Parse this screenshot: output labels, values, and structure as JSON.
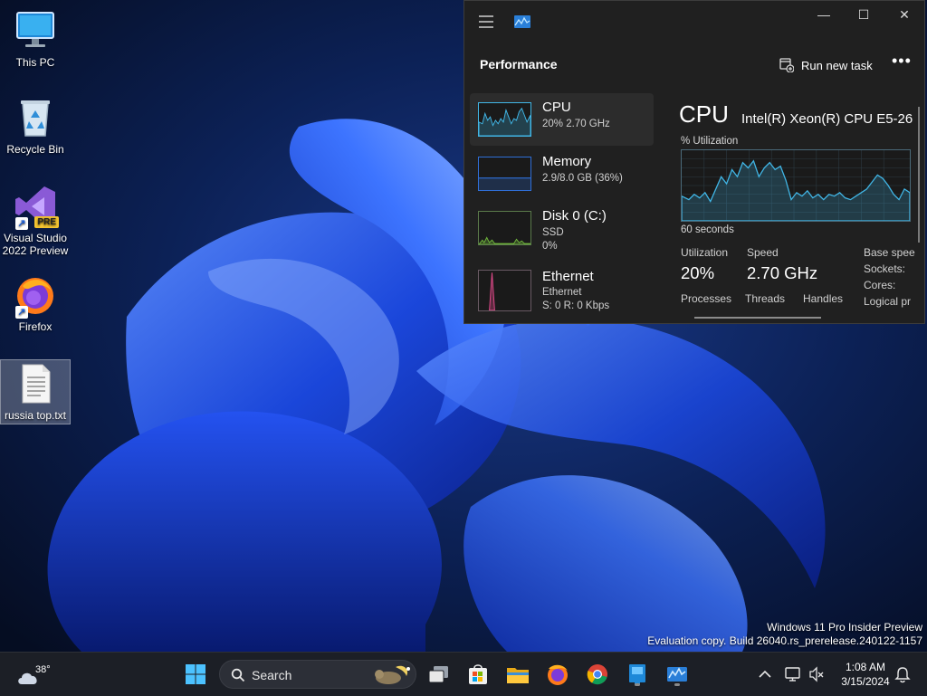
{
  "desktop": {
    "icons": [
      {
        "label": "This PC"
      },
      {
        "label": "Recycle Bin"
      },
      {
        "label": "Visual Studio 2022 Preview",
        "badge": "PRE"
      },
      {
        "label": "Firefox"
      },
      {
        "label": "russia top.txt"
      }
    ],
    "watermark": {
      "line1": "Windows 11 Pro Insider Preview",
      "line2": "Evaluation copy. Build 26040.rs_prerelease.240122-1157"
    }
  },
  "task_manager": {
    "controls": {
      "minimize": "—",
      "maximize": "☐",
      "close": "✕"
    },
    "page_title": "Performance",
    "run_new_task": "Run new task",
    "more": "•••",
    "perf_items": [
      {
        "name": "CPU",
        "sub1": "20% 2.70 GHz",
        "sub2": ""
      },
      {
        "name": "Memory",
        "sub1": "2.9/8.0 GB (36%)",
        "sub2": ""
      },
      {
        "name": "Disk 0 (C:)",
        "sub1": "SSD",
        "sub2": "0%"
      },
      {
        "name": "Ethernet",
        "sub1": "Ethernet",
        "sub2": "S: 0 R: 0 Kbps"
      }
    ],
    "detail": {
      "title": "CPU",
      "model": "Intel(R) Xeon(R) CPU E5-26",
      "graph_label": "% Utilization",
      "graph_span": "60 seconds",
      "utilization_label": "Utilization",
      "utilization_value": "20%",
      "speed_label": "Speed",
      "speed_value": "2.70 GHz",
      "processes_label": "Processes",
      "threads_label": "Threads",
      "handles_label": "Handles",
      "base_speed_label": "Base spee",
      "sockets_label": "Sockets:",
      "cores_label": "Cores:",
      "logical_label": "Logical pr"
    },
    "colors": {
      "cpu": "#41b6e6",
      "memory": "#2f6fd8",
      "disk": "#6fb53c",
      "ethernet": "#e04a8a"
    }
  },
  "taskbar": {
    "weather_temp": "38°",
    "search_placeholder": "Search",
    "clock_time": "1:08 AM",
    "clock_date": "3/15/2024",
    "apps": [
      "start-icon",
      "task-view-icon",
      "store-icon",
      "file-explorer-icon",
      "firefox-icon",
      "chrome-icon",
      "app-icon",
      "task-manager-icon"
    ]
  }
}
